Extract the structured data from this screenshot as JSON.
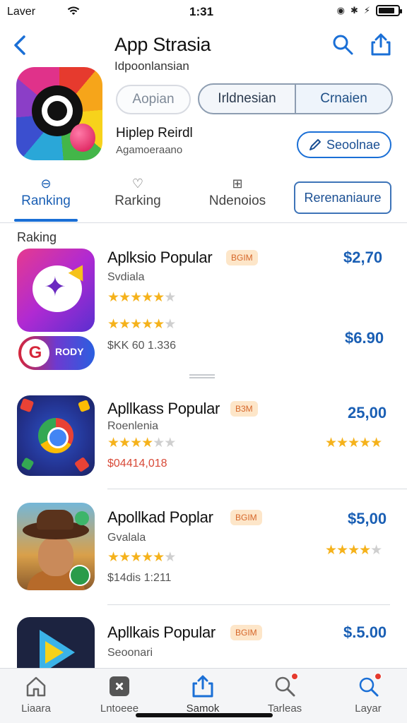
{
  "status": {
    "carrier": "Laver",
    "time": "1:31"
  },
  "header": {
    "title": "App Strasia",
    "subtitle": "Idpoonlansian",
    "seg_left": "Aopian",
    "seg_mid": "Irldnesian",
    "seg_right": "Crnaien",
    "meta_name": "Hiplep Reirdl",
    "meta_sub": "Agamoeraano",
    "action_label": "Seoolnae"
  },
  "tabs": {
    "items": [
      {
        "label": "Ranking"
      },
      {
        "label": "Rarking"
      },
      {
        "label": "Ndenoios"
      }
    ],
    "boxed_label": "Rerenaniaure"
  },
  "section_label": "Raking",
  "rows": [
    {
      "title": "Aplksio Popular",
      "badge": "BGIM",
      "sub": "Svdiala",
      "rating": 4.5,
      "rating2": 4.5,
      "stat": "$KK 60 1.336",
      "price": "$2,70",
      "price2": "$6.90",
      "gpill_text": "RODY"
    },
    {
      "title": "Apllkass Popular",
      "badge": "B3M",
      "sub": "Roenlenia",
      "rating": 3.5,
      "stat": "$04414,018",
      "price": "25,00",
      "right_rating": 4.5
    },
    {
      "title": "Apollkad Poplar",
      "badge": "BGIM",
      "sub": "Gvalala",
      "rating": 4.5,
      "stat": "$14dis 1:211",
      "price": "$5,00",
      "right_rating": 4.0
    },
    {
      "title": "Apllkais Popular",
      "badge": "BGIM",
      "sub": "Seoonari",
      "price": "$.5.00"
    }
  ],
  "bottom_tabs": [
    {
      "label": "Liaara"
    },
    {
      "label": "Lntoeee"
    },
    {
      "label": "Samok"
    },
    {
      "label": "Tarleas"
    },
    {
      "label": "Layar"
    }
  ],
  "colors": {
    "accent": "#1a6fd6",
    "price": "#1a5fb4",
    "star": "#f5b21b",
    "badge_bg": "#fde6c9",
    "badge_text": "#d6672a"
  }
}
